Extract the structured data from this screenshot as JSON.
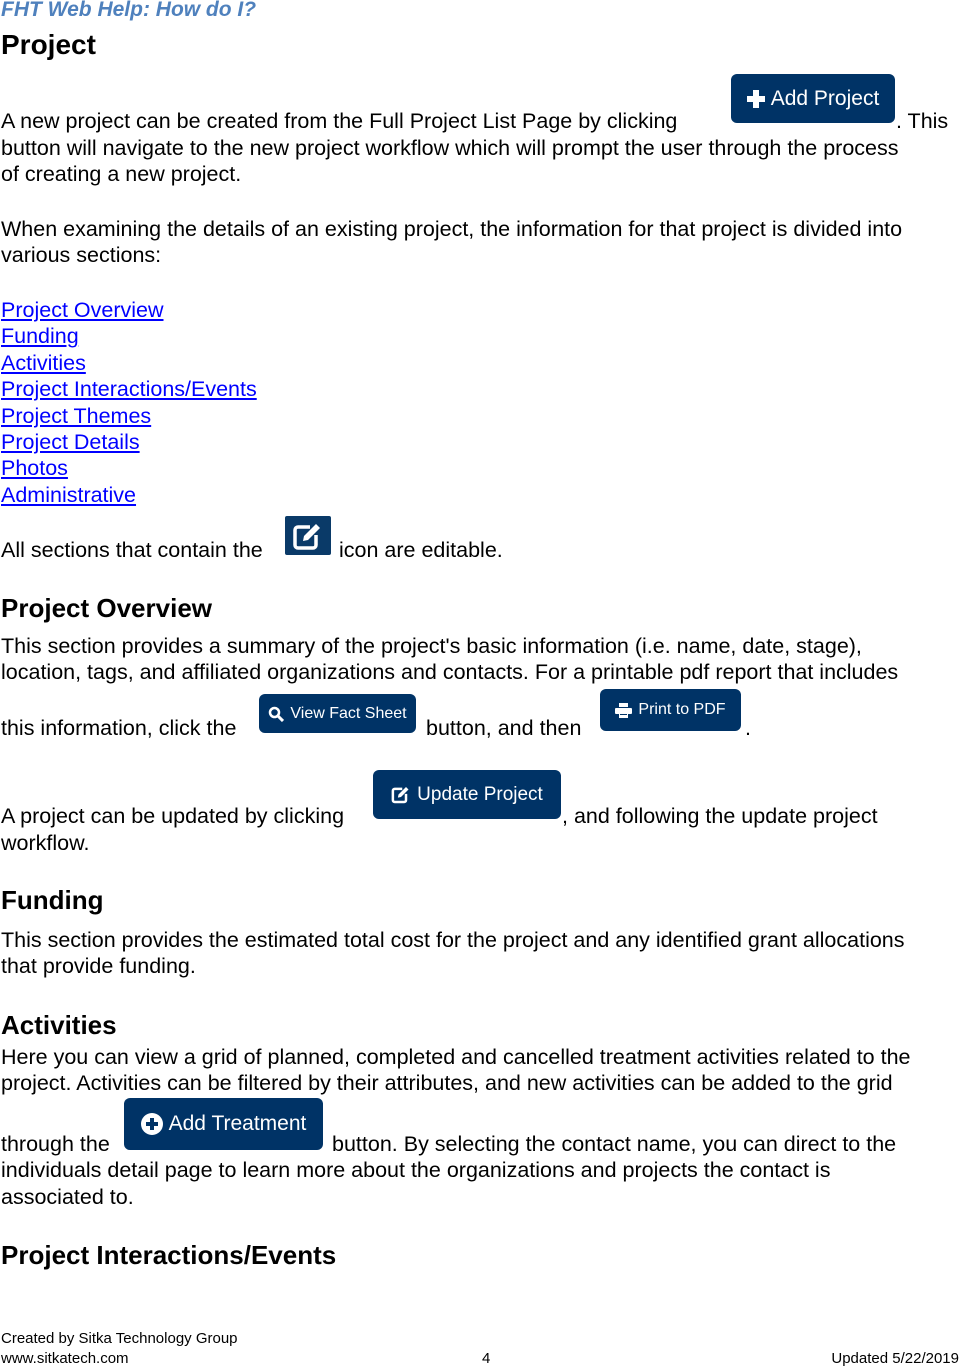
{
  "header": {
    "title": "FHT Web Help: How do I?"
  },
  "page_title": "Project",
  "intro": {
    "line1_before": "A new project can be created from the Full Project List Page by clicking",
    "line1_after": ".  This",
    "line2": "button will navigate to the new project workflow which will prompt the user through the process",
    "line3": "of creating a new project.",
    "line4": "When examining the details of an existing project, the information for that project is divided into",
    "line5": "various sections:"
  },
  "buttons": {
    "add_project": "Add Project",
    "edit_icon": "edit",
    "view_fact_sheet": "View Fact Sheet",
    "print_to_pdf": "Print to PDF",
    "update_project": "Update Project",
    "add_treatment": "Add Treatment"
  },
  "section_links": [
    "Project Overview",
    "Funding",
    "Activities",
    "Project Interactions/Events",
    "Project Themes",
    "Project Details",
    "Photos",
    "Administrative"
  ],
  "editable_note": {
    "before": "All sections that contain the",
    "after": "icon are editable."
  },
  "overview": {
    "heading": "Project Overview",
    "line1": "This section provides a summary of the project's basic information (i.e. name, date, stage),",
    "line2": "location, tags, and affiliated organizations and contacts.  For a printable pdf report that includes",
    "line3_a": "this information, click the",
    "line3_b": "button, and then",
    "line3_c": ".",
    "line4_a": "A project can be updated by clicking",
    "line4_b": ", and following the update project",
    "line5": "workflow."
  },
  "funding": {
    "heading": "Funding",
    "line1": "This section provides the estimated total cost for the project and any identified grant allocations",
    "line2": "that provide funding."
  },
  "activities": {
    "heading": "Activities",
    "line1": "Here you can view a grid of planned, completed and cancelled treatment activities related to the",
    "line2": "project.  Activities can be filtered by their attributes, and new activities can be added to the grid",
    "line3_a": "through the",
    "line3_b": "button.  By selecting the contact name, you can direct to the",
    "line4": "individuals detail page to learn more about the organizations and projects the contact is",
    "line5": "associated to."
  },
  "interactions": {
    "heading": "Project Interactions/Events"
  },
  "footer": {
    "created_by": "Created by Sitka Technology Group",
    "website": "www.sitkatech.com",
    "page_number": "4",
    "updated": "Updated 5/22/2019"
  }
}
